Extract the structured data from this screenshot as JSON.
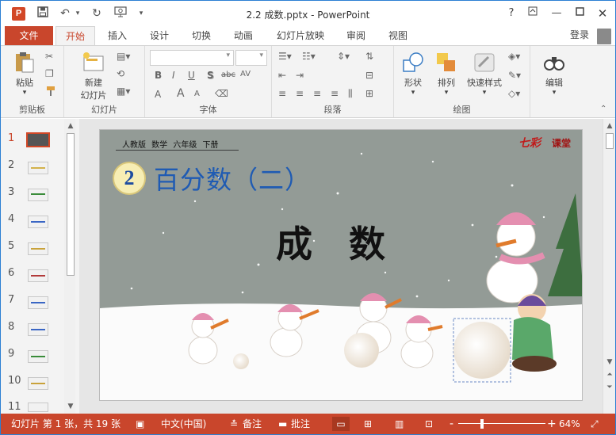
{
  "window": {
    "title": "2.2 成数.pptx - PowerPoint",
    "app_icon": "P",
    "help": "?",
    "colors": {
      "accent": "#c9462c",
      "brand": "#d24726"
    }
  },
  "ribbon_tabs": [
    "文件",
    "开始",
    "插入",
    "设计",
    "切换",
    "动画",
    "幻灯片放映",
    "审阅",
    "视图"
  ],
  "active_tab": "开始",
  "login_label": "登录",
  "ribbon": {
    "clipboard": {
      "group_label": "剪贴板",
      "paste_label": "粘贴"
    },
    "slides": {
      "group_label": "幻灯片",
      "new_slide_line1": "新建",
      "new_slide_line2": "幻灯片"
    },
    "font": {
      "group_label": "字体",
      "bold": "B",
      "italic": "I",
      "underline": "U",
      "shadow": "S",
      "strike": "abc",
      "spacing": "AV",
      "font_color": "A",
      "grow": "A",
      "shrink": "A"
    },
    "paragraph": {
      "group_label": "段落"
    },
    "drawing": {
      "group_label": "绘图",
      "shapes_label": "形状",
      "arrange_label": "排列",
      "quick_styles_label": "快速样式"
    },
    "editing": {
      "group_label": "编辑",
      "edit_label": "编辑"
    }
  },
  "thumbnails": [
    {
      "num": "1",
      "selected": true
    },
    {
      "num": "2",
      "selected": false
    },
    {
      "num": "3",
      "selected": false
    },
    {
      "num": "4",
      "selected": false
    },
    {
      "num": "5",
      "selected": false
    },
    {
      "num": "6",
      "selected": false
    },
    {
      "num": "7",
      "selected": false
    },
    {
      "num": "8",
      "selected": false
    },
    {
      "num": "9",
      "selected": false
    },
    {
      "num": "10",
      "selected": false
    },
    {
      "num": "11",
      "selected": false
    }
  ],
  "slide": {
    "edition": "人教版 数学 六年级 下册",
    "badge_number": "2",
    "heading": "百分数（二）",
    "title": "成数",
    "logo_main": "七彩",
    "logo_sub": "课堂"
  },
  "status": {
    "slide_info": "幻灯片 第 1 张，共 19 张",
    "language": "中文(中国)",
    "notes": "备注",
    "comments": "批注",
    "zoom_minus": "-",
    "zoom_plus": "+",
    "zoom": "64%"
  }
}
